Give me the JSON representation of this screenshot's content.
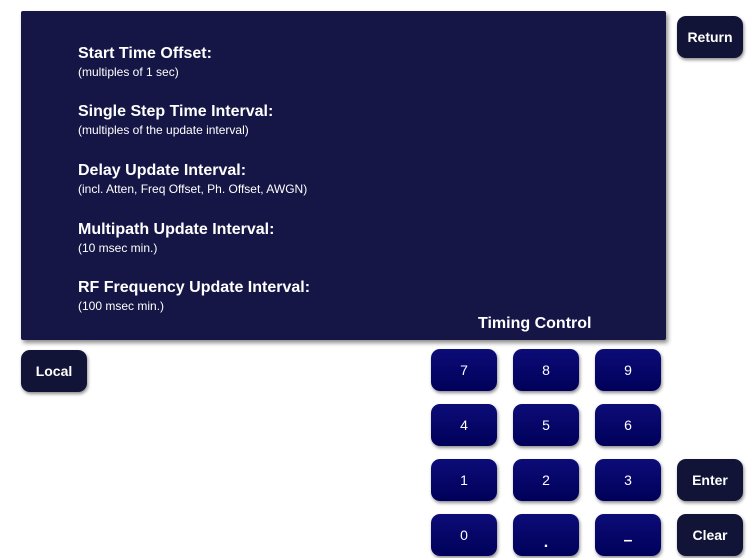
{
  "panel": {
    "title": "Timing Control",
    "params": [
      {
        "title": "Start Time Offset:",
        "sub": "(multiples of 1 sec)"
      },
      {
        "title": "Single Step Time Interval:",
        "sub": "(multiples of the update interval)"
      },
      {
        "title": "Delay Update Interval:",
        "sub": "(incl. Atten, Freq Offset, Ph. Offset, AWGN)"
      },
      {
        "title": "Multipath Update Interval:",
        "sub": "(10 msec min.)"
      },
      {
        "title": "RF Frequency Update Interval:",
        "sub": "(100 msec min.)"
      }
    ]
  },
  "buttons": {
    "return": "Return",
    "local": "Local",
    "enter": "Enter",
    "clear": "Clear"
  },
  "keypad": {
    "k7": "7",
    "k8": "8",
    "k9": "9",
    "k4": "4",
    "k5": "5",
    "k6": "6",
    "k1": "1",
    "k2": "2",
    "k3": "3",
    "k0": "0",
    "dot": ".",
    "minus": "–"
  }
}
